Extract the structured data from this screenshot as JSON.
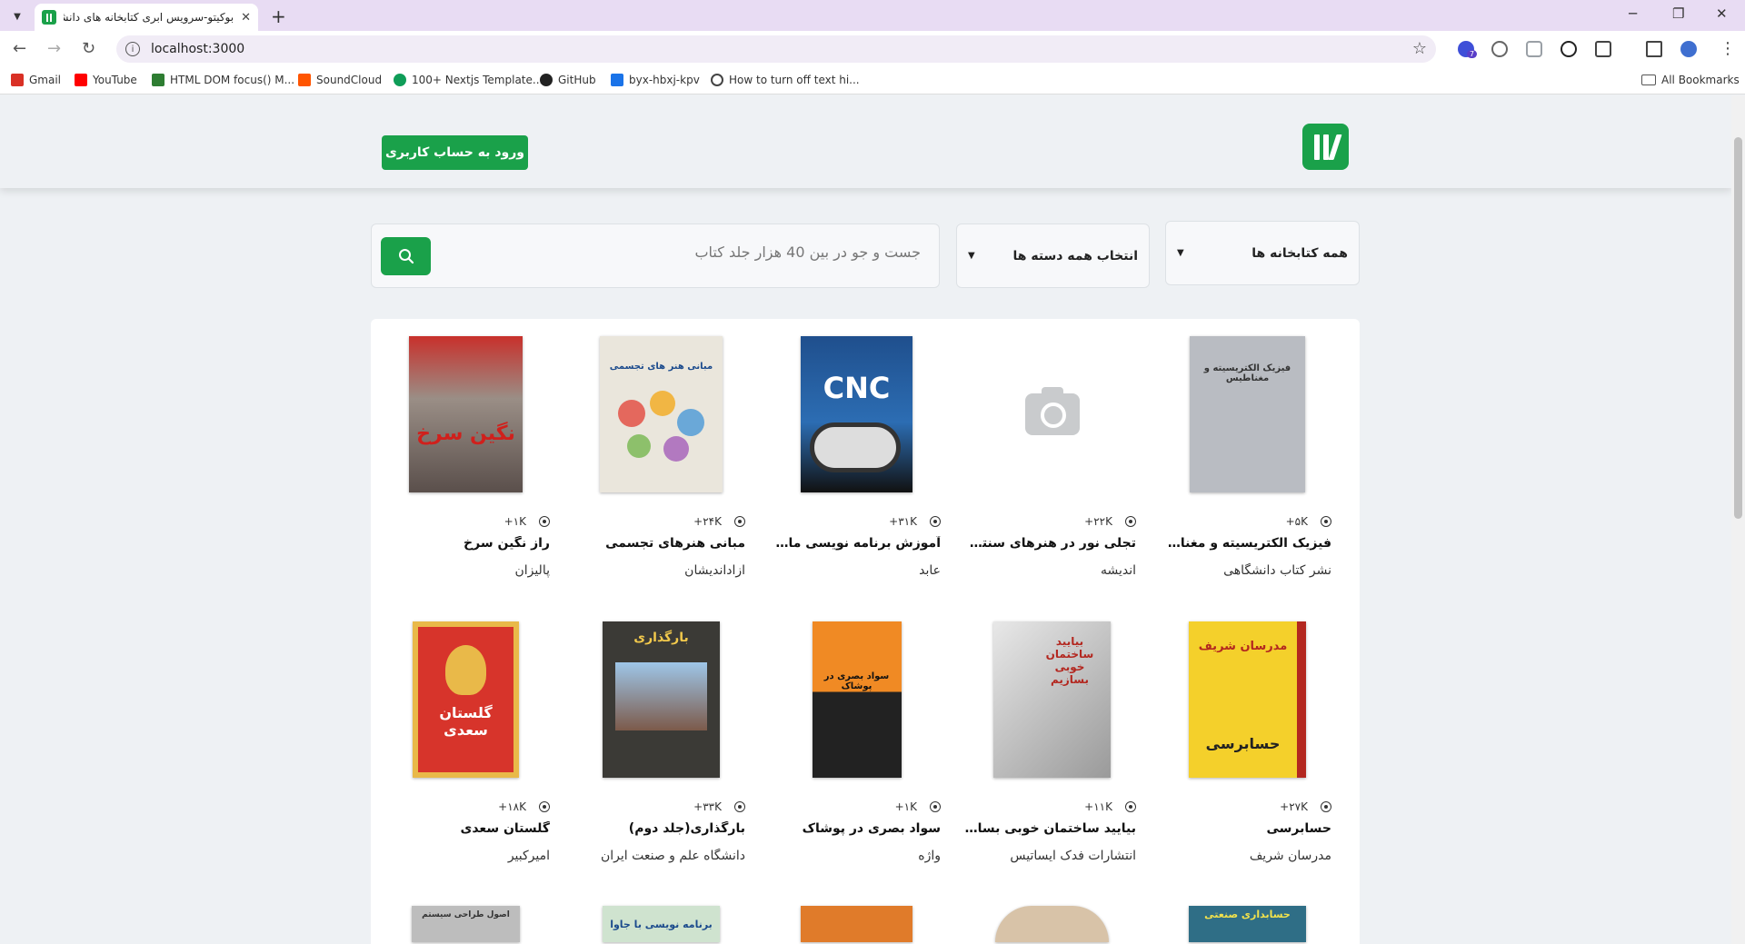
{
  "browser": {
    "tab_title": "بوکیتو-سرویس ابری کتابخانه های دانشگاه",
    "url": "localhost:3000",
    "bookmarks": [
      {
        "label": "Gmail",
        "color": "#d93025"
      },
      {
        "label": "YouTube",
        "color": "#ff0000"
      },
      {
        "label": "HTML DOM focus() M...",
        "color": "#2e7d32"
      },
      {
        "label": "SoundCloud",
        "color": "#ff5500"
      },
      {
        "label": "100+ Nextjs Template...",
        "color": "#0f9d58"
      },
      {
        "label": "GitHub",
        "color": "#222222"
      },
      {
        "label": "byx-hbxj-kpv",
        "color": "#1a73e8"
      },
      {
        "label": "How to turn off text hi...",
        "color": "#444444"
      }
    ],
    "all_bookmarks": "All Bookmarks",
    "ext_badge": "7"
  },
  "header": {
    "login_label": "ورود به حساب کاربری",
    "brand_color": "#1aa14a"
  },
  "filters": {
    "library": "همه کتابخانه ها",
    "category": "انتخاب همه دسته ها",
    "search_placeholder": "جست و جو در بین 40 هزار جلد کتاب"
  },
  "books": [
    {
      "title": "فیزیک الکتریسیته و مغناطیس",
      "publisher": "نشر کتاب دانشگاهی",
      "views": "۵K+",
      "cover": "gray",
      "cover_text": "فیزیک الکتریسیته و مغناطیس"
    },
    {
      "title": "تجلی نور در هنرهای سنتی ایران",
      "publisher": "اندیشه",
      "views": "۲۲K+",
      "cover": "none",
      "cover_text": ""
    },
    {
      "title": "آموزش برنامه نویسی ماشین های CNC",
      "publisher": "عابد",
      "views": "۳۱K+",
      "cover": "cnc",
      "cover_text": "CNC"
    },
    {
      "title": "مبانی هنرهای تجسمی",
      "publisher": "ازاداندیشان",
      "views": "۲۴K+",
      "cover": "art",
      "cover_text": "مبانی هنر های تجسمی"
    },
    {
      "title": "راز نگین سرخ",
      "publisher": "پالیزان",
      "views": "۱K+",
      "cover": "red",
      "cover_text": "نگین سرخ"
    },
    {
      "title": "حسابرسی",
      "publisher": "مدرسان شریف",
      "views": "۲۷K+",
      "cover": "yellow",
      "cover_text": "حسابرسی"
    },
    {
      "title": "بیایید ساختمان خوبی بسازیم",
      "publisher": "انتشارات فدک ایساتیس",
      "views": "۱۱K+",
      "cover": "building",
      "cover_text": "بیایید ساختمان خوبی بسازیم"
    },
    {
      "title": "سواد بصری در پوشاک",
      "publisher": "واژه",
      "views": "۱K+",
      "cover": "orange",
      "cover_text": "سواد بصری در پوشاک"
    },
    {
      "title": "بارگذاری(جلد دوم)",
      "publisher": "دانشگاه علم و صنعت ایران",
      "views": "۳۳K+",
      "cover": "bridge",
      "cover_text": "بارگذاری"
    },
    {
      "title": "گلستان سعدی",
      "publisher": "امیرکبیر",
      "views": "۱۸K+",
      "cover": "golestan",
      "cover_text": "گلستان سعدی"
    }
  ],
  "partial_covers": [
    {
      "cover_text": "حسابداری صنعتی",
      "color": "#2f6e86"
    },
    {
      "cover_text": "",
      "color": "#d8c3a8"
    },
    {
      "cover_text": "",
      "color": "#e07b2a"
    },
    {
      "cover_text": "برنامه نویسی با جاوا",
      "color": "#cfe3cf"
    },
    {
      "cover_text": "اصول طراحی سیستم",
      "color": "#bdbdbd"
    }
  ]
}
